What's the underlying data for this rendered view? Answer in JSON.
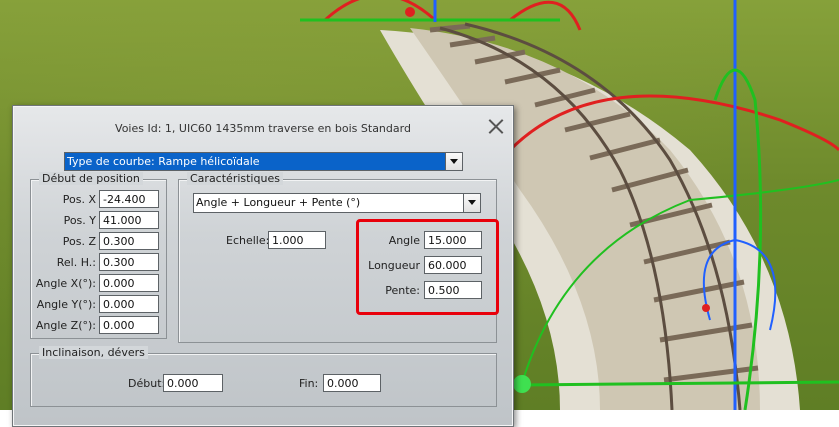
{
  "dialog": {
    "title": "Voies Id: 1, UIC60 1435mm traverse en bois Standard",
    "curve_type": "Type de courbe: Rampe hélicoïdale",
    "position": {
      "legend": "Début de position",
      "fields": [
        {
          "label": "Pos. X",
          "value": "-24.400"
        },
        {
          "label": "Pos. Y",
          "value": "41.000"
        },
        {
          "label": "Pos. Z",
          "value": "0.300"
        },
        {
          "label": "Rel. H.:",
          "value": "0.300"
        },
        {
          "label": "Angle X(°):",
          "value": "0.000"
        },
        {
          "label": "Angle Y(°):",
          "value": "0.000"
        },
        {
          "label": "Angle Z(°):",
          "value": "0.000"
        }
      ]
    },
    "characteristics": {
      "legend": "Caractéristiques",
      "mode": "Angle + Longueur + Pente (°)",
      "scale_label": "Echelle:",
      "scale_value": "1.000",
      "angle_label": "Angle",
      "angle_value": "15.000",
      "length_label": "Longueur",
      "length_value": "60.000",
      "slope_label": "Pente:",
      "slope_value": "0.500"
    },
    "inclination": {
      "legend": "Inclinaison, dévers",
      "start_label": "Début:",
      "start_value": "0.000",
      "end_label": "Fin:",
      "end_value": "0.000"
    }
  },
  "colors": {
    "highlight": "#e8000b",
    "selection": "#0a63c9",
    "gizmo_x": "#e02020",
    "gizmo_y": "#20c020",
    "gizmo_z": "#2060ff"
  }
}
